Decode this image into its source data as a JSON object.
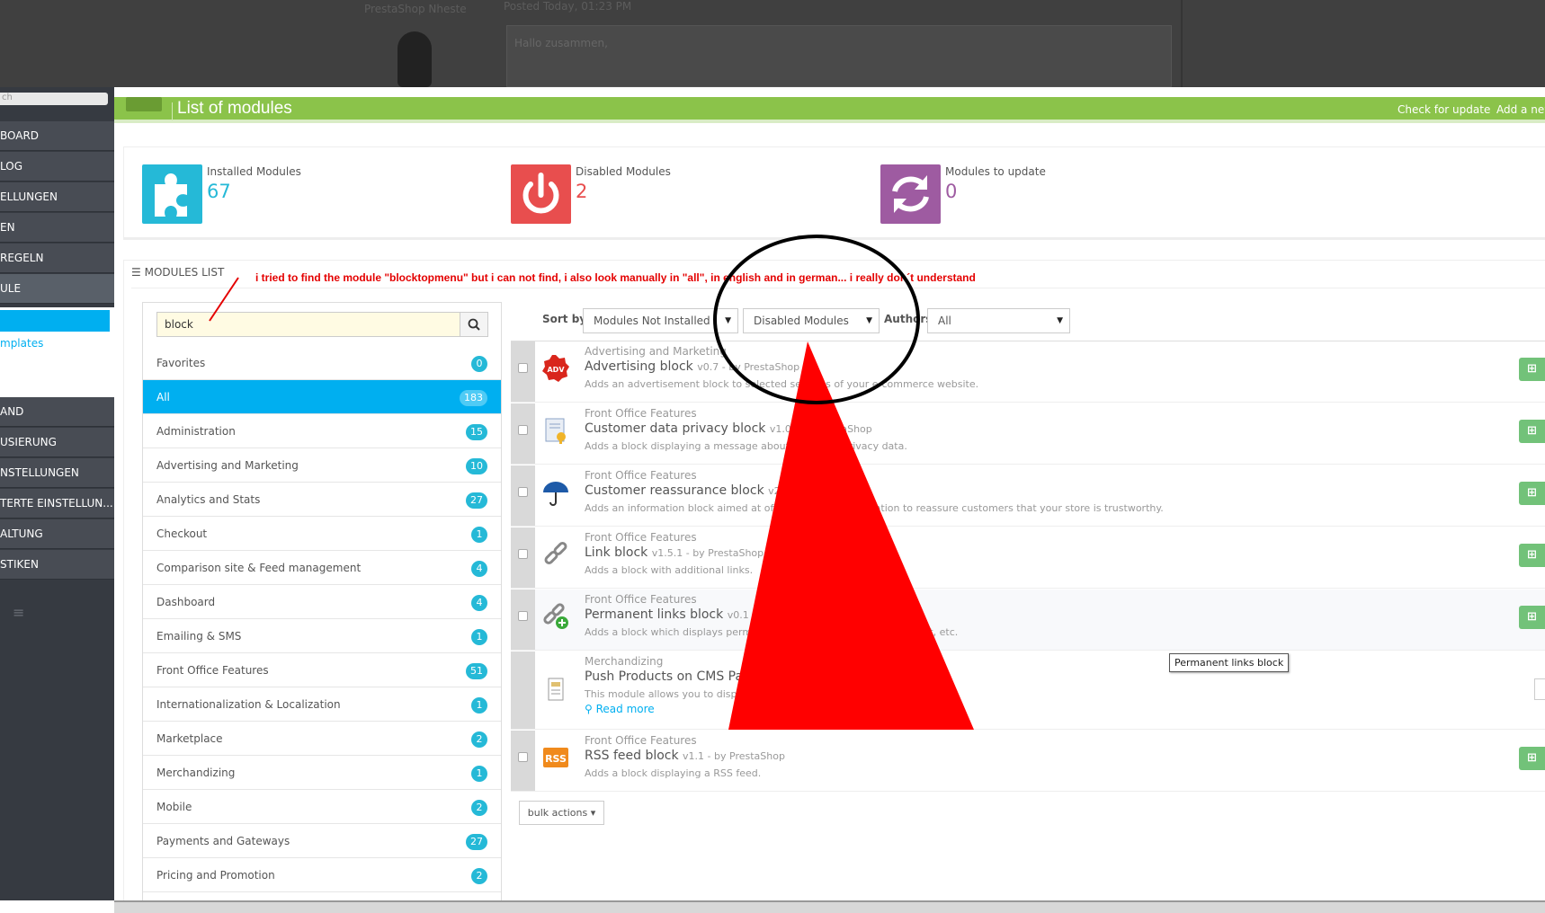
{
  "forum": {
    "author": "PrestaShop Nheste",
    "date": "Posted Today, 01:23 PM",
    "post": "Hallo zusammen,"
  },
  "sidebar": {
    "search_placeholder": "ch",
    "items": [
      {
        "label": "BOARD"
      },
      {
        "label": "LOG"
      },
      {
        "label": "ELLUNGEN"
      },
      {
        "label": "EN"
      },
      {
        "label": "REGELN"
      },
      {
        "label": "ULE"
      },
      {
        "label": "AND"
      },
      {
        "label": "USIERUNG"
      },
      {
        "label": "NSTELLUNGEN"
      },
      {
        "label": "TERTE EINSTELLUN..."
      },
      {
        "label": "ALTUNG"
      },
      {
        "label": "STIKEN"
      }
    ],
    "sub_link": "mplates"
  },
  "toolbar": {
    "title": "List of modules",
    "check_update": "Check for update",
    "add_new": "Add a new"
  },
  "kpi": [
    {
      "label": "Installed Modules",
      "value": "67",
      "color": "#25b9d7",
      "icon": "puzzle-icon"
    },
    {
      "label": "Disabled Modules",
      "value": "2",
      "color": "#e84e4e",
      "icon": "power-icon"
    },
    {
      "label": "Modules to update",
      "value": "0",
      "color": "#9e5ba1",
      "icon": "refresh-icon"
    }
  ],
  "panel": {
    "heading": "MODULES LIST",
    "annotation": "i tried to find the module \"blocktopmenu\" but i can not find, i also look manually in \"all\", in english and in german... i really don´t understand"
  },
  "search": {
    "value": "block"
  },
  "categories": [
    {
      "label": "Favorites",
      "count": "0"
    },
    {
      "label": "All",
      "count": "183"
    },
    {
      "label": "Administration",
      "count": "15"
    },
    {
      "label": "Advertising and Marketing",
      "count": "10"
    },
    {
      "label": "Analytics and Stats",
      "count": "27"
    },
    {
      "label": "Checkout",
      "count": "1"
    },
    {
      "label": "Comparison site & Feed management",
      "count": "4"
    },
    {
      "label": "Dashboard",
      "count": "4"
    },
    {
      "label": "Emailing & SMS",
      "count": "1"
    },
    {
      "label": "Front Office Features",
      "count": "51"
    },
    {
      "label": "Internationalization & Localization",
      "count": "1"
    },
    {
      "label": "Marketplace",
      "count": "2"
    },
    {
      "label": "Merchandizing",
      "count": "1"
    },
    {
      "label": "Mobile",
      "count": "2"
    },
    {
      "label": "Payments and Gateways",
      "count": "27"
    },
    {
      "label": "Pricing and Promotion",
      "count": "2"
    }
  ],
  "sort": {
    "label": "Sort by",
    "status": "Modules Not Installed",
    "enabled": "Disabled Modules",
    "authors_label": "Authors",
    "authors": "All"
  },
  "modules": [
    {
      "category": "Advertising and Marketing",
      "name": "Advertising block",
      "meta": "v0.7 - by PrestaShop",
      "desc": "Adds an advertisement block to selected sections of your e-commerce website.",
      "icon": "adv-icon"
    },
    {
      "category": "Front Office Features",
      "name": "Customer data privacy block",
      "meta": "v1.0 - by PrestaShop",
      "desc": "Adds a block displaying a message about customer privacy data.",
      "icon": "privacy-icon"
    },
    {
      "category": "Front Office Features",
      "name": "Customer reassurance block",
      "meta": "v2.0 - by PrestaShop",
      "desc": "Adds an information block aimed at offering helpful information to reassure customers that your store is trustworthy.",
      "icon": "umbrella-icon"
    },
    {
      "category": "Front Office Features",
      "name": "Link block",
      "meta": "v1.5.1 - by PrestaShop",
      "desc": "Adds a block with additional links.",
      "icon": "link-icon"
    },
    {
      "category": "Front Office Features",
      "name": "Permanent links block",
      "meta": "v0.1 - by PrestaShop",
      "desc": "Adds a block which displays permanent links such as sitemap, contact, etc.",
      "icon": "link-add-icon"
    },
    {
      "category": "Merchandizing",
      "name": "Push Products on CMS Pages",
      "meta": "",
      "desc": "This module allows you to display products on your CMS pages",
      "icon": "cms-icon",
      "read_more": "Read more"
    },
    {
      "category": "Front Office Features",
      "name": "RSS feed block",
      "meta": "v1.1 - by PrestaShop",
      "desc": "Adds a block displaying a RSS feed.",
      "icon": "rss-icon"
    }
  ],
  "tooltip": "Permanent links block",
  "bulk_actions": "bulk actions"
}
